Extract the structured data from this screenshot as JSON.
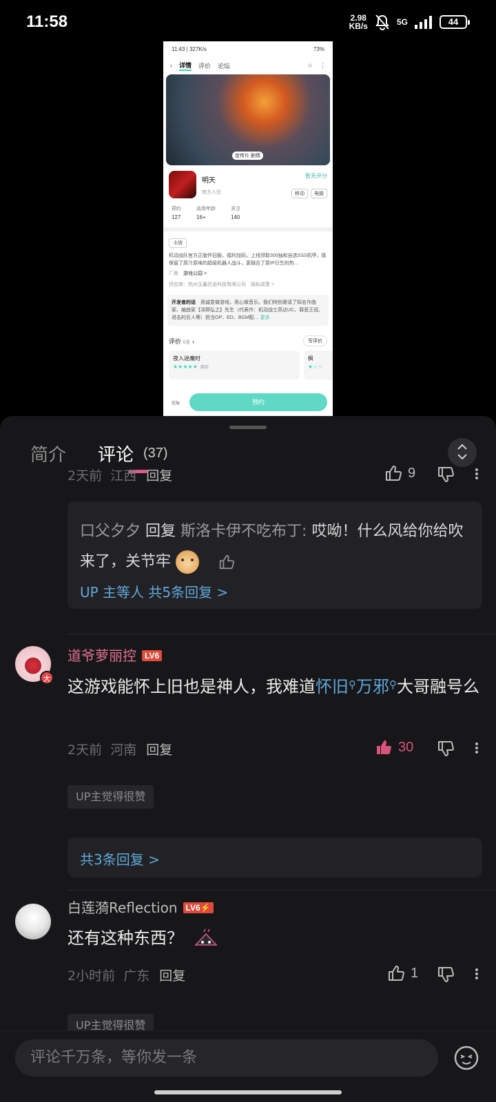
{
  "status_bar": {
    "time": "11:58",
    "speed": "2.98",
    "speed_unit": "KB/s",
    "network": "5G",
    "battery": "44"
  },
  "phone_screenshot": {
    "status_time": "11:43 | 327K/s",
    "status_battery": "73%",
    "tabs": [
      "详情",
      "评价",
      "论坛"
    ],
    "banner_tag": "宣传片",
    "banner_tag2": "剧情",
    "game_name": "明天",
    "official": "官方入驻",
    "see_rating": "暂无评分",
    "platforms": [
      "移动",
      "电脑"
    ],
    "stats": [
      {
        "label": "预约",
        "value": "127"
      },
      {
        "label": "适用年龄",
        "value": "16+"
      },
      {
        "label": "关注",
        "value": "140"
      }
    ],
    "tag": "卡牌",
    "desc": "机动战队官方正版怀旧服，福利加码，上线领取300抽和自选SSS机甲，既保留了原汁原味的超级机器人战斗，更融合了原IP衍生的热…",
    "vendor_label": "厂商",
    "vendor": "游戏公园 >",
    "publisher": "供应商：杭州玉鑫信息科技有限公司　隐私政策 >",
    "dev_title": "开发者的话",
    "dev_text": "用诚意做游戏，用心做音乐。我们特别邀请了知名作曲家、编曲家【泽野弘之】先生（代表作：机动战士高达UC、罪恶王冠、进击的巨人等）担当OP、ED、BGM配…",
    "dev_more": "更多",
    "review_label": "评价",
    "review_count": "6条",
    "write_review": "写评价",
    "card1_name": "夜入迷魔时",
    "card1_stars": "★★★★★",
    "card1_sub": "期待",
    "card2_name": "枫",
    "card2_stars": "★☆☆",
    "forum": "论坛",
    "book_button": "预约"
  },
  "panel": {
    "tab_intro": "简介",
    "tab_comment": "评论",
    "comment_count": "(37)"
  },
  "comment0": {
    "time": "2天前",
    "location": "江西",
    "reply_label": "回复",
    "likes": "9",
    "sub_user": "口父夕夕",
    "sub_reply_word": "回复",
    "sub_target": "斯洛卡伊不吃布丁:",
    "sub_text": "哎呦！什么风给你给吹来了，关节牢",
    "sub_link": "UP 主等人 共5条回复 >"
  },
  "comment1": {
    "user": "道爷萝丽控",
    "level": "LV6",
    "avatar_badge": "大",
    "text_a": "这游戏能怀上旧也是神人，我难道",
    "kw1": "怀旧",
    "kw2": "万邪",
    "text_b": "大哥融号么",
    "time": "2天前",
    "location": "河南",
    "reply_label": "回复",
    "likes": "30",
    "up_tag": "UP主觉得很赞",
    "replies": "共3条回复 >"
  },
  "comment2": {
    "user": "白莲漪Reflection",
    "level": "LV6⚡",
    "text": "还有这种东西？",
    "time": "2小时前",
    "location": "广东",
    "reply_label": "回复",
    "likes": "1",
    "up_tag": "UP主觉得很赞"
  },
  "input": {
    "placeholder": "评论千万条，等你发一条"
  },
  "colors": {
    "accent_pink": "#e05a8c",
    "link_blue": "#5fa8d8",
    "liked_pink": "#d9537a",
    "teal": "#5fd9c5"
  }
}
